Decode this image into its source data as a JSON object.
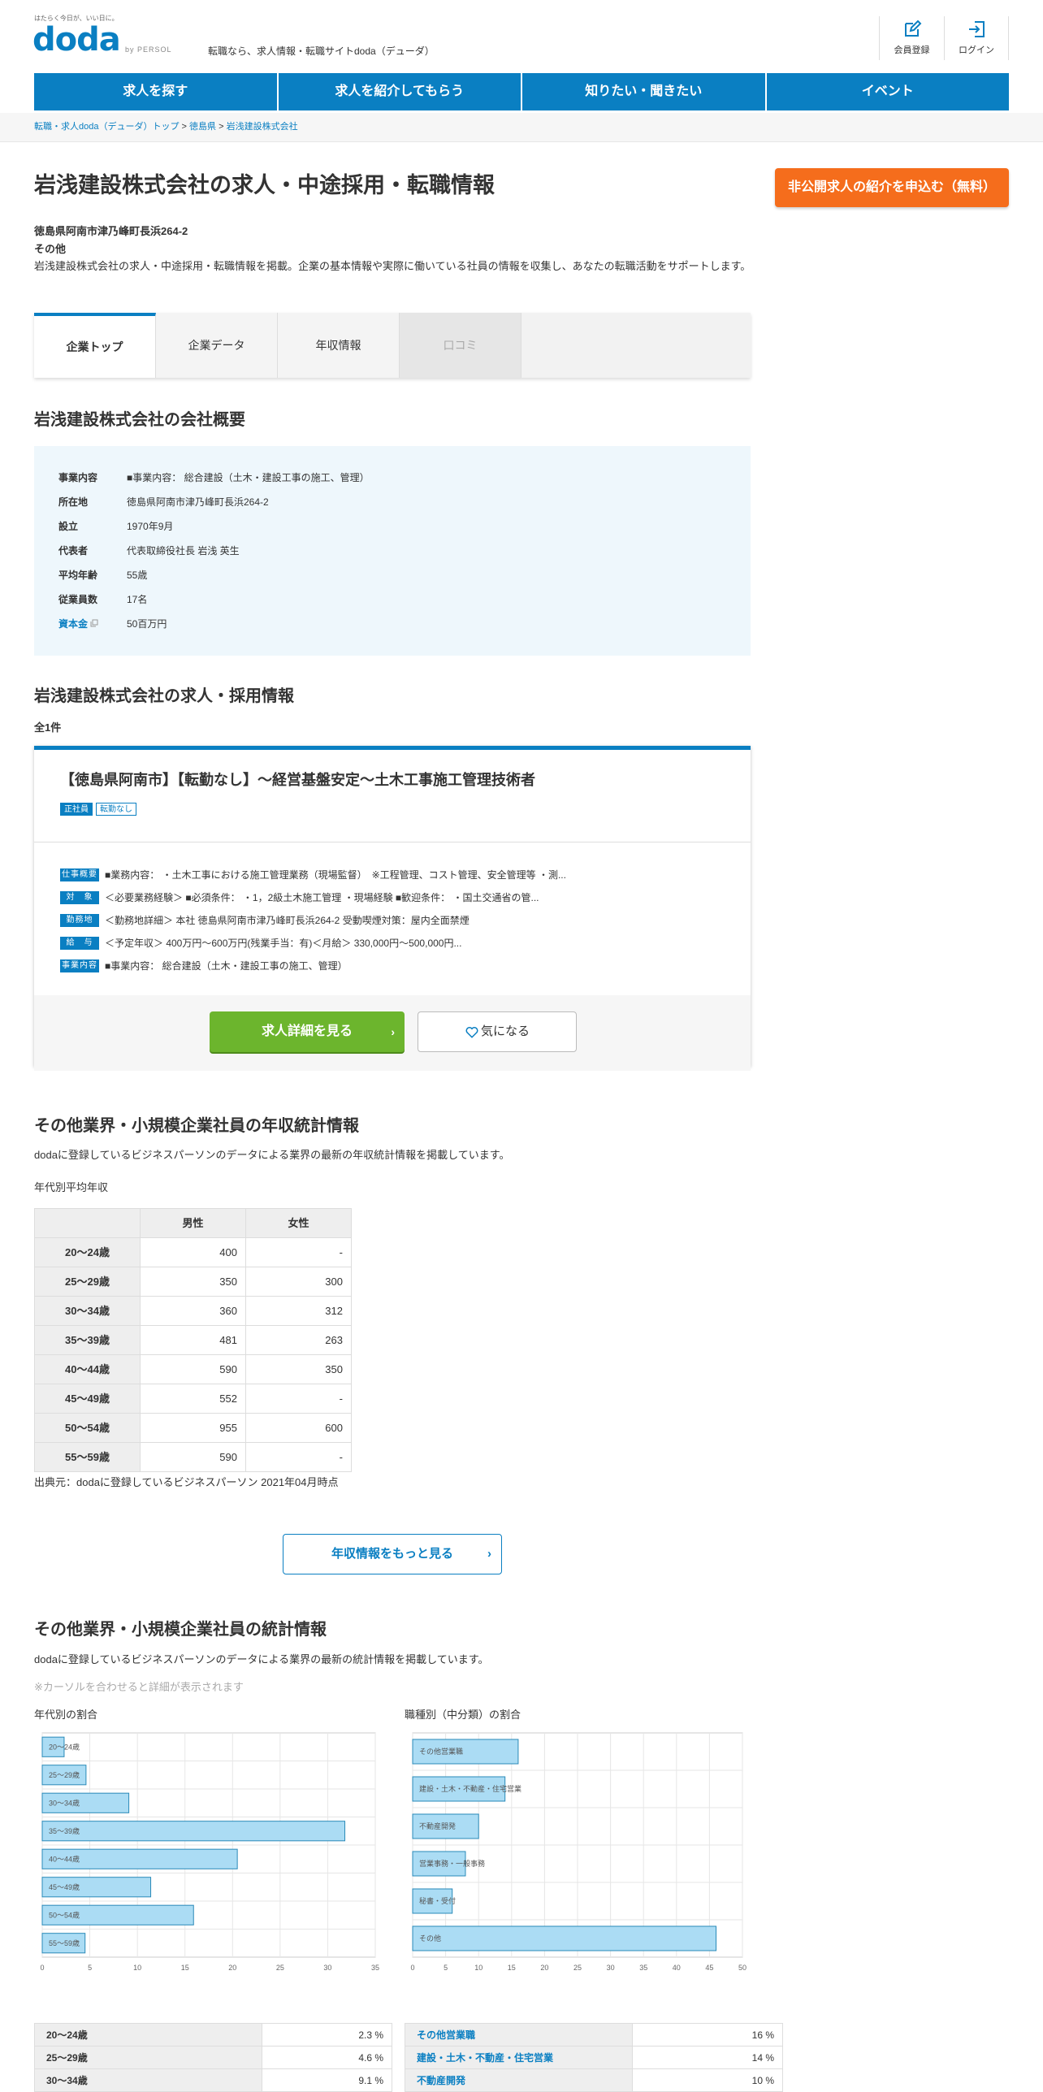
{
  "header": {
    "tagline": "はたらく今日が、いい日に。",
    "logo": "doda",
    "by": "by PERSOL",
    "desc": "転職なら、求人情報・転職サイトdoda（デューダ）",
    "register": "会員登録",
    "login": "ログイン"
  },
  "nav": [
    "求人を探す",
    "求人を紹介してもらう",
    "知りたい・聞きたい",
    "イベント"
  ],
  "breadcrumb": [
    "転職・求人doda（デューダ）トップ",
    "徳島県",
    "岩浅建設株式会社"
  ],
  "page": {
    "title": "岩浅建設株式会社の求人・中途採用・転職情報",
    "cta": "非公開求人の紹介を申込む（無料）",
    "address": "徳島県阿南市津乃峰町長浜264-2",
    "industry": "その他",
    "description": "岩浅建設株式会社の求人・中途採用・転職情報を掲載。企業の基本情報や実際に働いている社員の情報を収集し、あなたの転職活動をサポートします。"
  },
  "tabs": [
    "企業トップ",
    "企業データ",
    "年収情報",
    "口コミ"
  ],
  "overview": {
    "title": "岩浅建設株式会社の会社概要",
    "rows": [
      {
        "k": "事業内容",
        "v": "■事業内容： 総合建設（土木・建設工事の施工、管理）"
      },
      {
        "k": "所在地",
        "v": "徳島県阿南市津乃峰町長浜264-2"
      },
      {
        "k": "設立",
        "v": "1970年9月"
      },
      {
        "k": "代表者",
        "v": "代表取締役社長 岩浅 英生"
      },
      {
        "k": "平均年齢",
        "v": "55歳"
      },
      {
        "k": "従業員数",
        "v": "17名"
      },
      {
        "k": "資本金",
        "v": "50百万円"
      }
    ]
  },
  "jobs": {
    "title": "岩浅建設株式会社の求人・採用情報",
    "count": "全1件",
    "card": {
      "title": "【徳島県阿南市】【転勤なし】～経営基盤安定～土木工事施工管理技術者",
      "badges": [
        "正社員",
        "転勤なし"
      ],
      "rows": [
        {
          "label": "仕事概要",
          "text": "■業務内容： ・土木工事における施工管理業務（現場監督）　※工程管理、コスト管理、安全管理等 ・測..."
        },
        {
          "label": "対　象",
          "text": "＜必要業務経験＞ ■必須条件： ・1，2級土木施工管理 ・現場経験 ■歓迎条件： ・国土交通省の管..."
        },
        {
          "label": "勤務地",
          "text": "＜勤務地詳細＞ 本社 徳島県阿南市津乃峰町長浜264-2 受動喫煙対策：屋内全面禁煙"
        },
        {
          "label": "給　与",
          "text": "＜予定年収＞ 400万円～600万円(残業手当：有)＜月給＞ 330,000円～500,000円..."
        },
        {
          "label": "事業内容",
          "text": "■事業内容： 総合建設（土木・建設工事の施工、管理）"
        }
      ],
      "detail_btn": "求人詳細を見る",
      "fav_btn": "気になる"
    }
  },
  "salary": {
    "title": "その他業界・小規模企業社員の年収統計情報",
    "lead": "dodaに登録しているビジネスパーソンのデータによる業界の最新の年収統計情報を掲載しています。",
    "caption": "年代別平均年収",
    "headers": [
      "",
      "男性",
      "女性"
    ],
    "rows": [
      {
        "age": "20～24歳",
        "m": "400",
        "f": "-"
      },
      {
        "age": "25～29歳",
        "m": "350",
        "f": "300"
      },
      {
        "age": "30～34歳",
        "m": "360",
        "f": "312"
      },
      {
        "age": "35～39歳",
        "m": "481",
        "f": "263"
      },
      {
        "age": "40～44歳",
        "m": "590",
        "f": "350"
      },
      {
        "age": "45～49歳",
        "m": "552",
        "f": "-"
      },
      {
        "age": "50～54歳",
        "m": "955",
        "f": "600"
      },
      {
        "age": "55～59歳",
        "m": "590",
        "f": "-"
      }
    ],
    "source": "出典元：dodaに登録しているビジネスパーソン 2021年04月時点",
    "more_btn": "年収情報をもっと見る"
  },
  "stats": {
    "title": "その他業界・小規模企業社員の統計情報",
    "lead": "dodaに登録しているビジネスパーソンのデータによる業界の最新の統計情報を掲載しています。",
    "note": "※カーソルを合わせると詳細が表示されます",
    "age_title": "年代別の割合",
    "job_title": "職種別（中分類）の割合",
    "age_table": [
      {
        "k": "20～24歳",
        "v": "2.3 %"
      },
      {
        "k": "25～29歳",
        "v": "4.6 %"
      },
      {
        "k": "30～34歳",
        "v": "9.1 %"
      }
    ],
    "job_table": [
      {
        "k": "その他営業職",
        "v": "16 %"
      },
      {
        "k": "建設・土木・不動産・住宅営業",
        "v": "14 %"
      },
      {
        "k": "不動産開発",
        "v": "10 %"
      }
    ]
  },
  "chart_data": [
    {
      "type": "bar",
      "orientation": "horizontal",
      "categories": [
        "20～24歳",
        "25～29歳",
        "30～34歳",
        "35～39歳",
        "40～44歳",
        "45～49歳",
        "50～54歳",
        "55～59歳"
      ],
      "values": [
        2.3,
        4.6,
        9.1,
        31.8,
        20.5,
        11.4,
        15.9,
        4.5
      ],
      "xlim": [
        0,
        35
      ],
      "xticks": [
        0,
        5,
        10,
        15,
        20,
        25,
        30,
        35
      ],
      "grid": true,
      "color": "#abdcf4"
    },
    {
      "type": "bar",
      "orientation": "horizontal",
      "categories": [
        "その他営業職",
        "建設・土木・不動産・住宅営業",
        "不動産開発",
        "営業事務・一般事務",
        "秘書・受付",
        "その他"
      ],
      "values": [
        16,
        14,
        10,
        8,
        6,
        46
      ],
      "xlim": [
        0,
        50
      ],
      "xticks": [
        0,
        5,
        10,
        15,
        20,
        25,
        30,
        35,
        40,
        45,
        50
      ],
      "grid": true,
      "color": "#abdcf4"
    }
  ],
  "colors": {
    "primary": "#0a7fc2",
    "orange": "#f56d1c",
    "green": "#6cb52d",
    "bar": "#abdcf4"
  }
}
